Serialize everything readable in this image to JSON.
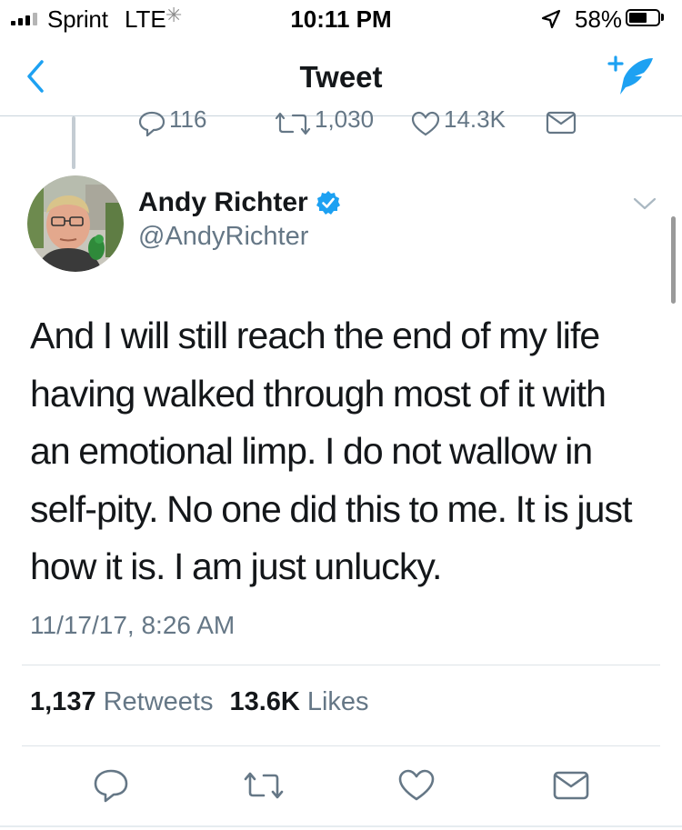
{
  "status_bar": {
    "carrier": "Sprint",
    "network": "LTE",
    "time": "10:11 PM",
    "battery": "58%",
    "battery_level": 0.58
  },
  "nav": {
    "title": "Tweet",
    "back_icon": "chevron-left-icon",
    "compose_icon": "compose-tweet-icon"
  },
  "previous_tweet": {
    "replies": "116",
    "retweets": "1,030",
    "likes": "14.3K"
  },
  "tweet": {
    "author_name": "Andy Richter",
    "handle": "@AndyRichter",
    "verified": true,
    "text_lines": [
      "And I will still reach the end of my life",
      "having walked through most of it with",
      "an emotional limp. I do not wallow in",
      "self-pity. No one did this to me. It is just",
      "how it is. I am just unlucky."
    ],
    "timestamp": "11/17/17, 8:26 AM",
    "retweets_count": "1,137",
    "retweets_label": "Retweets",
    "likes_count": "13.6K",
    "likes_label": "Likes"
  },
  "colors": {
    "accent": "#1da1f2",
    "text_primary": "#14171a",
    "text_secondary": "#657786",
    "divider": "#dde3e8"
  }
}
